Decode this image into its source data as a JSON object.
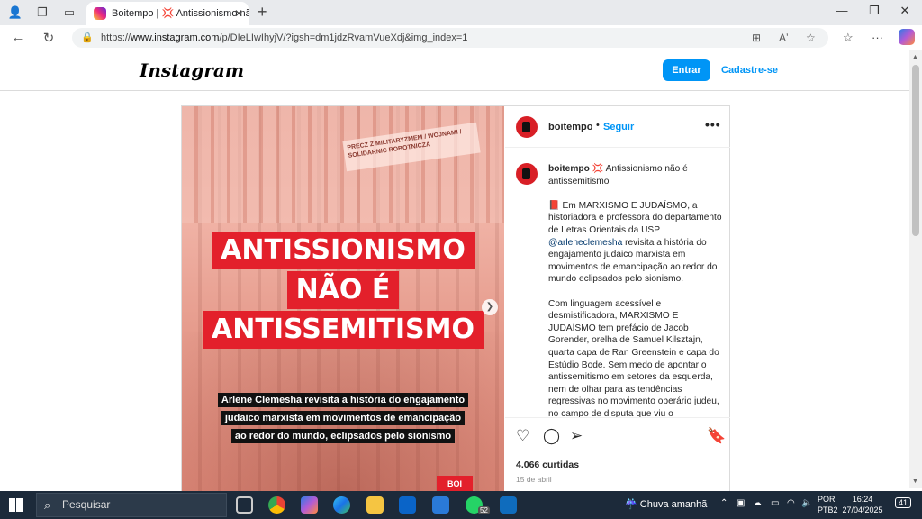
{
  "browser": {
    "tab_title": "Boitempo | 💢 Antissionismo não",
    "url_prefix": "https://",
    "url_domain": "www.instagram.com",
    "url_path": "/p/DIeLIwIhyjV/?igsh=dm1jdzRvamVueXdj&img_index=1"
  },
  "header": {
    "logo": "Instagram",
    "login_label": "Entrar",
    "signup_label": "Cadastre-se"
  },
  "post": {
    "username": "boitempo",
    "dot": "•",
    "follow_label": "Seguir",
    "more": "•••",
    "media": {
      "banner_text": "PRECZ Z MILITARYZMEM / WOJNAMI / SOLIDARNIC ROBOTNICZA",
      "headline_1": "ANTISSIONISMO",
      "headline_2": "NÃO É",
      "headline_3": "ANTISSEMITISMO",
      "sub_1": "Arlene Clemesha revisita a história do engajamento",
      "sub_2": "judaico marxista em movimentos de emancipação",
      "sub_3": "ao redor do mundo, eclipsados pelo sionismo",
      "badge": "BOI"
    },
    "caption": {
      "username": "boitempo",
      "first": "💢 Antissionismo não é antissemitismo",
      "p2_before": "📕 Em MARXISMO E JUDAÍSMO, a historiadora e professora do departamento de Letras Orientais da USP ",
      "mention": "@arleneclemesha",
      "p2_after": " revisita a história do engajamento judaico marxista em movimentos de emancipação ao redor do mundo eclipsados pelo sionismo.",
      "p3": "Com linguagem acessível e desmistificadora, MARXISMO E JUDAÍSMO tem prefácio de Jacob Gorender, orelha de Samuel Kilsztajn, quarta capa de Ran Greenstein e capa do Estúdio Bode. Sem medo de apontar o antissemitismo em setores da esquerda, nem de olhar para as tendências regressivas no movimento operário judeu, no campo de disputa que viu o"
    },
    "likes": "4.066 curtidas",
    "date": "15 de abril"
  },
  "taskbar": {
    "search_placeholder": "Pesquisar",
    "whatsapp_badge": "52",
    "weather": "Chuva amanhã",
    "lang_1": "POR",
    "lang_2": "PTB2",
    "time": "16:24",
    "date": "27/04/2025",
    "notifications": "41"
  },
  "colors": {
    "accent": "#0095f6",
    "headline_red": "#e3202b",
    "taskbar": "#1c2a3a"
  }
}
